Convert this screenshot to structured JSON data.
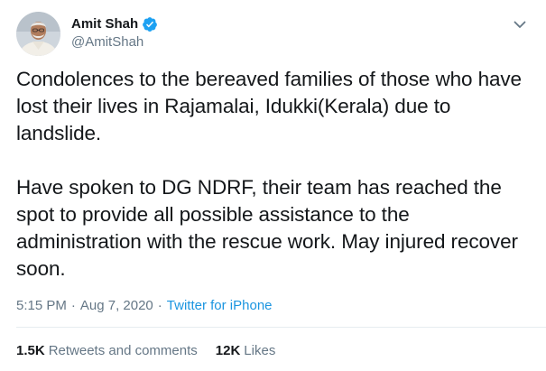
{
  "author": {
    "display_name": "Amit Shah",
    "handle": "@AmitShah",
    "verified": true,
    "avatar_icon": "profile-photo"
  },
  "tweet": {
    "paragraph_1": "Condolences to the bereaved families of those who have lost their lives in Rajamalai, Idukki(Kerala) due to landslide.",
    "paragraph_2": "Have spoken to DG NDRF, their team has reached the spot to provide all possible assistance to the administration with the rescue work. May injured recover soon."
  },
  "meta": {
    "time": "5:15 PM",
    "separator_1": "·",
    "date": "Aug 7, 2020",
    "separator_2": "·",
    "source": "Twitter for iPhone"
  },
  "stats": {
    "retweets_count": "1.5K",
    "retweets_label": "Retweets and comments",
    "likes_count": "12K",
    "likes_label": "Likes"
  },
  "colors": {
    "text_primary": "#14171a",
    "text_secondary": "#657786",
    "link_blue": "#1b95e0",
    "verified_blue": "#1da1f2",
    "divider": "#e6ecf0"
  },
  "icons": {
    "verified": "verified-badge-icon",
    "menu": "chevron-down-icon"
  }
}
